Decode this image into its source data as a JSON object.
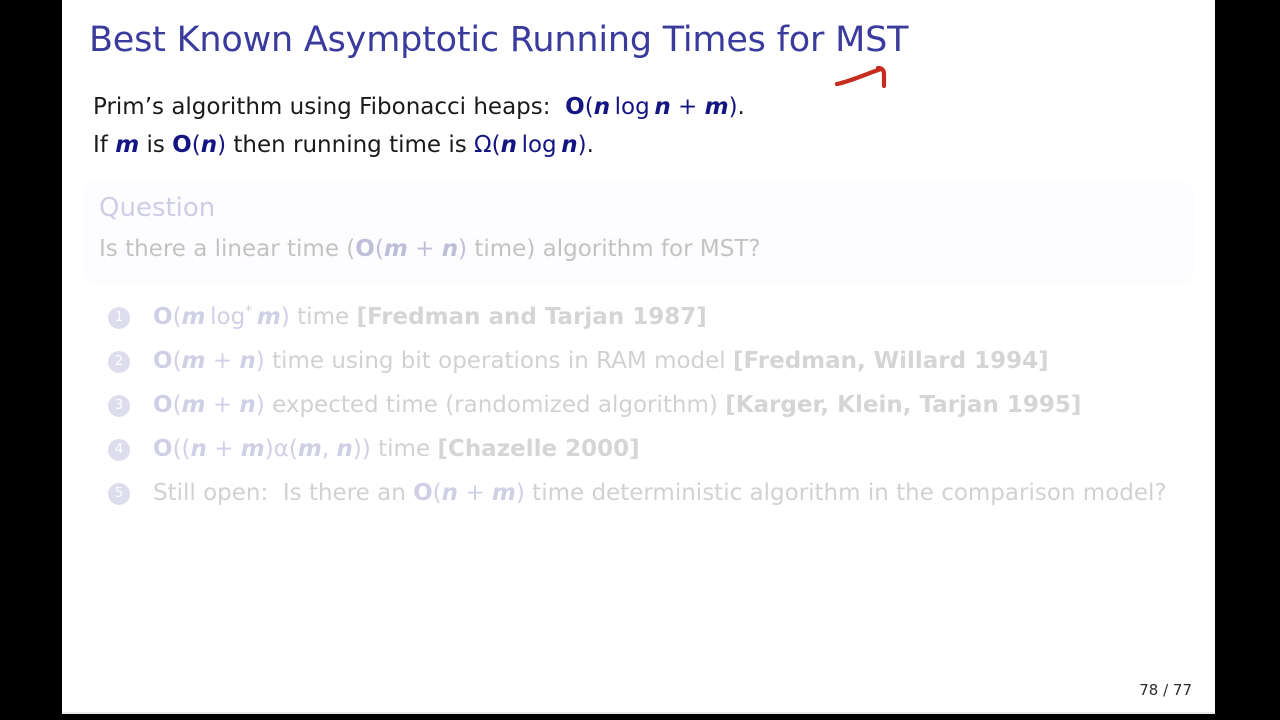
{
  "slide": {
    "title": "Best Known Asymptotic Running Times for MST",
    "title_color": "#3b3b9e",
    "background_color": "#ffffff",
    "letterbox_color": "#000000"
  },
  "intro": {
    "line1": {
      "lead": "Prim’s algorithm using Fibonacci heaps:  ",
      "math_O": "O",
      "math_open": "(",
      "math_n1": "n",
      "math_log": "log",
      "math_n2": "n",
      "math_plus": "+",
      "math_m": "m",
      "math_close": ")",
      "tail": "."
    },
    "line2": {
      "lead": "If ",
      "m": "m",
      "mid1": " is ",
      "O": "O",
      "open1": "(",
      "n1": "n",
      "close1": ")",
      "mid2": " then running time is ",
      "omega": "Ω",
      "open2": "(",
      "n2": "n",
      "log": "log",
      "n3": "n",
      "close2": ")",
      "tail": "."
    }
  },
  "annotation": {
    "name": "red-hand-drawn-arrow",
    "color": "#c62d1f",
    "target": "m"
  },
  "question": {
    "heading": "Question",
    "body": {
      "lead": "Is there a linear time (",
      "O": "O",
      "open": "(",
      "m": "m",
      "plus": "+",
      "n": "n",
      "close": ")",
      "tail": " time) algorithm for MST?"
    }
  },
  "results": {
    "items": [
      {
        "number": "1",
        "parts": [
          {
            "t": "math-up",
            "v": "O"
          },
          {
            "t": "math-sym",
            "v": "("
          },
          {
            "t": "math",
            "v": "m"
          },
          {
            "t": "plain",
            "v": " "
          },
          {
            "t": "math-sym",
            "v": "log"
          },
          {
            "t": "sup",
            "v": "*"
          },
          {
            "t": "plain",
            "v": " "
          },
          {
            "t": "math",
            "v": "m"
          },
          {
            "t": "math-sym",
            "v": ")"
          },
          {
            "t": "plain",
            "v": " time "
          },
          {
            "t": "cite",
            "v": "[Fredman and Tarjan 1987]"
          }
        ]
      },
      {
        "number": "2",
        "parts": [
          {
            "t": "math-up",
            "v": "O"
          },
          {
            "t": "math-sym",
            "v": "("
          },
          {
            "t": "math",
            "v": "m"
          },
          {
            "t": "math-sym",
            "v": " + "
          },
          {
            "t": "math",
            "v": "n"
          },
          {
            "t": "math-sym",
            "v": ")"
          },
          {
            "t": "plain",
            "v": " time using bit operations in RAM model "
          },
          {
            "t": "cite",
            "v": "[Fredman, Willard 1994]"
          }
        ]
      },
      {
        "number": "3",
        "parts": [
          {
            "t": "math-up",
            "v": "O"
          },
          {
            "t": "math-sym",
            "v": "("
          },
          {
            "t": "math",
            "v": "m"
          },
          {
            "t": "math-sym",
            "v": " + "
          },
          {
            "t": "math",
            "v": "n"
          },
          {
            "t": "math-sym",
            "v": ")"
          },
          {
            "t": "plain",
            "v": " expected time (randomized algorithm) "
          },
          {
            "t": "cite",
            "v": "[Karger, Klein, Tarjan 1995]"
          }
        ]
      },
      {
        "number": "4",
        "parts": [
          {
            "t": "math-up",
            "v": "O"
          },
          {
            "t": "math-sym",
            "v": "(("
          },
          {
            "t": "math",
            "v": "n"
          },
          {
            "t": "math-sym",
            "v": " + "
          },
          {
            "t": "math",
            "v": "m"
          },
          {
            "t": "math-sym",
            "v": ")"
          },
          {
            "t": "math-sym",
            "v": "α"
          },
          {
            "t": "math-sym",
            "v": "("
          },
          {
            "t": "math",
            "v": "m"
          },
          {
            "t": "math-sym",
            "v": ", "
          },
          {
            "t": "math",
            "v": "n"
          },
          {
            "t": "math-sym",
            "v": "))"
          },
          {
            "t": "plain",
            "v": " time "
          },
          {
            "t": "cite",
            "v": "[Chazelle 2000]"
          }
        ]
      },
      {
        "number": "5",
        "parts": [
          {
            "t": "plain",
            "v": "Still open:  Is there an "
          },
          {
            "t": "math-up",
            "v": "O"
          },
          {
            "t": "math-sym",
            "v": "("
          },
          {
            "t": "math",
            "v": "n"
          },
          {
            "t": "math-sym",
            "v": " + "
          },
          {
            "t": "math",
            "v": "m"
          },
          {
            "t": "math-sym",
            "v": ")"
          },
          {
            "t": "plain",
            "v": " time deterministic algorithm in the comparison model?"
          }
        ]
      }
    ]
  },
  "footer": {
    "page_number": "78 / 77"
  }
}
